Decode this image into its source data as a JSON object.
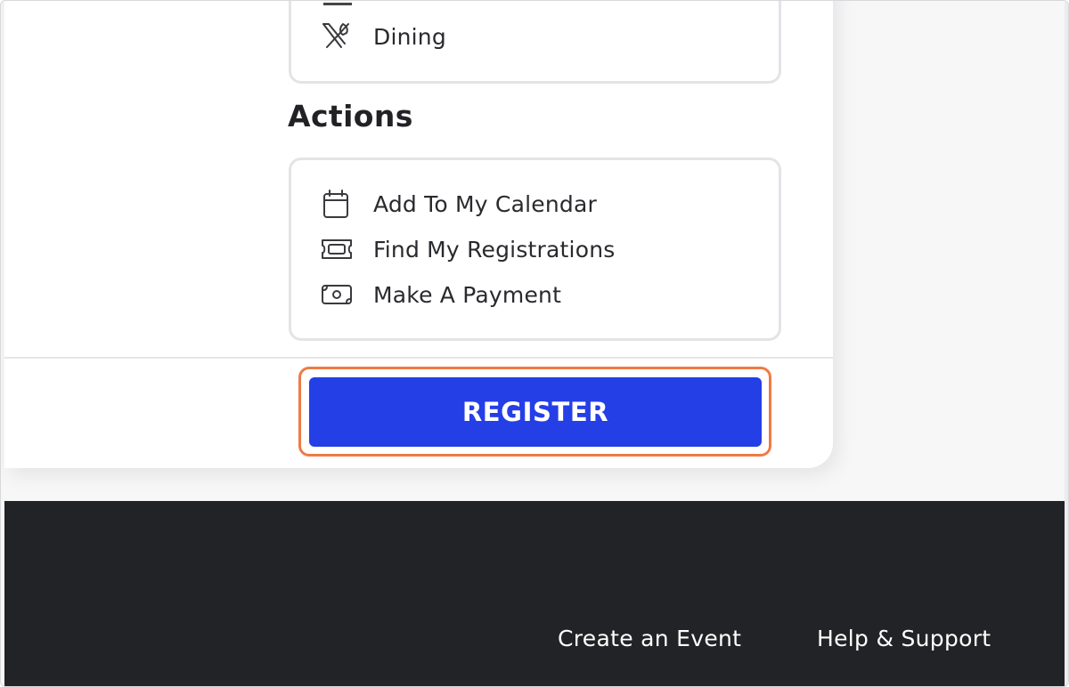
{
  "info": {
    "items": [
      {
        "label": "Dining",
        "icon": "fork-knife-icon"
      }
    ]
  },
  "actions": {
    "title": "Actions",
    "items": [
      {
        "label": "Add To My Calendar",
        "icon": "calendar-icon"
      },
      {
        "label": "Find My Registrations",
        "icon": "ticket-icon"
      },
      {
        "label": "Make A Payment",
        "icon": "money-icon"
      }
    ]
  },
  "register": {
    "label": "REGISTER",
    "color": "#253fe6",
    "highlight_color": "#f07a45"
  },
  "footer": {
    "links": [
      "Create an Event",
      "Help & Support"
    ],
    "background": "#222326"
  }
}
